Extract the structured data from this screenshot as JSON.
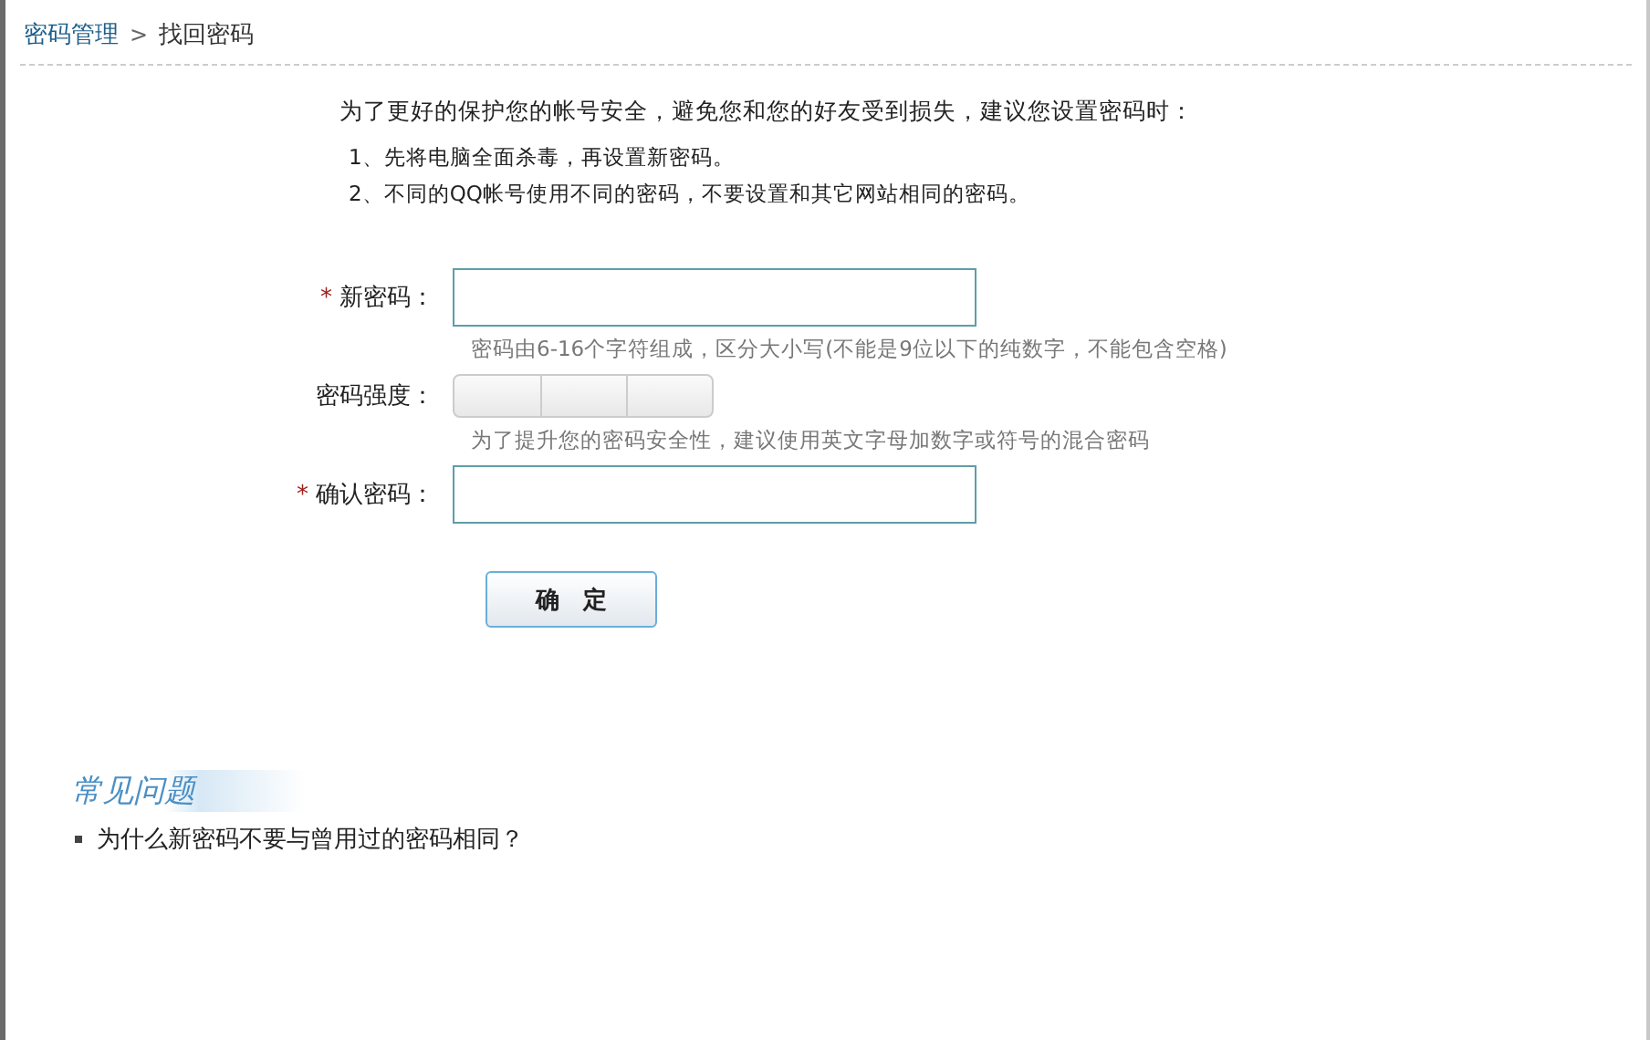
{
  "breadcrumb": {
    "parent": "密码管理",
    "separator": ">",
    "current": "找回密码"
  },
  "intro": {
    "heading": "为了更好的保护您的帐号安全，避免您和您的好友受到损失，建议您设置密码时：",
    "tips": [
      "1、先将电脑全面杀毒，再设置新密码。",
      "2、不同的QQ帐号使用不同的密码，不要设置和其它网站相同的密码。"
    ]
  },
  "form": {
    "fields": [
      {
        "kind": "input",
        "required": true,
        "label": "新密码：",
        "hint": "密码由6-16个字符组成，区分大小写(不能是9位以下的纯数字，不能包含空格)"
      },
      {
        "kind": "strength",
        "required": false,
        "label": "密码强度：",
        "hint": "为了提升您的密码安全性，建议使用英文字母加数字或符号的混合密码"
      },
      {
        "kind": "input",
        "required": true,
        "label": "确认密码："
      }
    ],
    "required_mark": "*",
    "submit": "确　定"
  },
  "faq": {
    "title": "常见问题",
    "items": [
      "为什么新密码不要与曾用过的密码相同？"
    ]
  }
}
